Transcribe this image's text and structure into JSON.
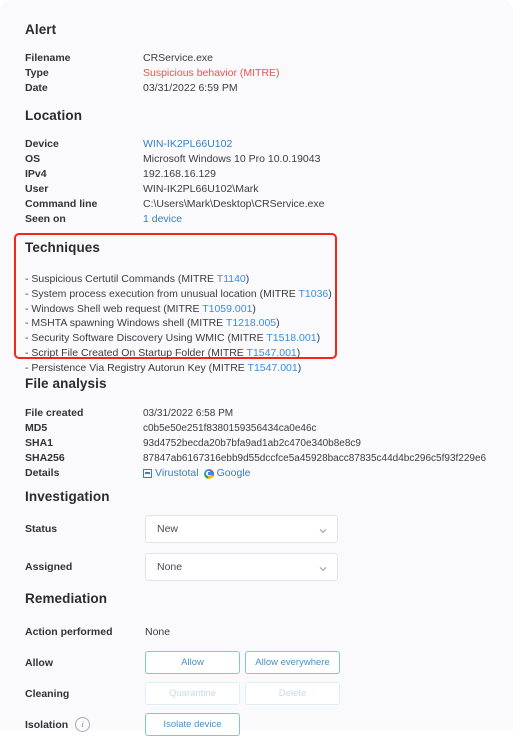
{
  "alert": {
    "heading": "Alert",
    "rows": [
      {
        "label": "Filename",
        "value": "CRService.exe",
        "style": "plain"
      },
      {
        "label": "Type",
        "value": "Suspicious behavior (MITRE)",
        "style": "danger"
      },
      {
        "label": "Date",
        "value": "03/31/2022 6:59 PM",
        "style": "plain"
      }
    ]
  },
  "location": {
    "heading": "Location",
    "rows": [
      {
        "label": "Device",
        "value": "WIN-IK2PL66U102",
        "style": "link"
      },
      {
        "label": "OS",
        "value": "Microsoft Windows 10 Pro 10.0.19043",
        "style": "plain"
      },
      {
        "label": "IPv4",
        "value": "192.168.16.129",
        "style": "plain"
      },
      {
        "label": "User",
        "value": "WIN-IK2PL66U102\\Mark",
        "style": "plain"
      },
      {
        "label": "Command line",
        "value": "C:\\Users\\Mark\\Desktop\\CRService.exe",
        "style": "plain"
      },
      {
        "label": "Seen on",
        "value": "1 device",
        "style": "link"
      }
    ]
  },
  "techniques": {
    "heading": "Techniques",
    "highlight_color": "#f8231b",
    "items": [
      {
        "text": "- Suspicious Certutil Commands (MITRE ",
        "id": "T1140",
        "tail": ")"
      },
      {
        "text": "- System process execution from unusual location (MITRE ",
        "id": "T1036",
        "tail": ")"
      },
      {
        "text": "- Windows Shell web request (MITRE ",
        "id": "T1059.001",
        "tail": ")"
      },
      {
        "text": "- MSHTA spawning Windows shell (MITRE ",
        "id": "T1218.005",
        "tail": ")"
      },
      {
        "text": "- Security Software Discovery Using WMIC (MITRE ",
        "id": "T1518.001",
        "tail": ")"
      },
      {
        "text": "- Script File Created On Startup Folder (MITRE ",
        "id": "T1547.001",
        "tail": ")"
      },
      {
        "text": "- Persistence Via Registry Autorun Key (MITRE ",
        "id": "T1547.001",
        "tail": ")"
      }
    ]
  },
  "file_analysis": {
    "heading": "File analysis",
    "rows": [
      {
        "label": "File created",
        "value": "03/31/2022 6:58 PM"
      },
      {
        "label": "MD5",
        "value": "c0b5e50e251f8380159356434ca0e46c"
      },
      {
        "label": "SHA1",
        "value": "93d4752becda20b7bfa9ad1ab2c470e340b8e8c9"
      },
      {
        "label": "SHA256",
        "value": "87847ab6167316ebb9d55dccfce5a45928bacc87835c44d4bc296c5f93f229e6"
      }
    ],
    "details_label": "Details",
    "details_links": [
      {
        "label": "Virustotal",
        "icon": "virustotal-icon"
      },
      {
        "label": "Google",
        "icon": "google-icon"
      }
    ]
  },
  "investigation": {
    "heading": "Investigation",
    "status": {
      "label": "Status",
      "value": "New"
    },
    "assigned": {
      "label": "Assigned",
      "value": "None"
    }
  },
  "remediation": {
    "heading": "Remediation",
    "action_performed": {
      "label": "Action performed",
      "value": "None"
    },
    "allow": {
      "label": "Allow",
      "buttons": [
        {
          "label": "Allow",
          "disabled": false
        },
        {
          "label": "Allow everywhere",
          "disabled": false
        }
      ]
    },
    "cleaning": {
      "label": "Cleaning",
      "buttons": [
        {
          "label": "Quarantine",
          "disabled": true
        },
        {
          "label": "Delete",
          "disabled": true
        }
      ]
    },
    "isolation": {
      "label": "Isolation",
      "info_icon": "info-icon",
      "buttons": [
        {
          "label": "Isolate device",
          "disabled": false
        }
      ]
    }
  }
}
